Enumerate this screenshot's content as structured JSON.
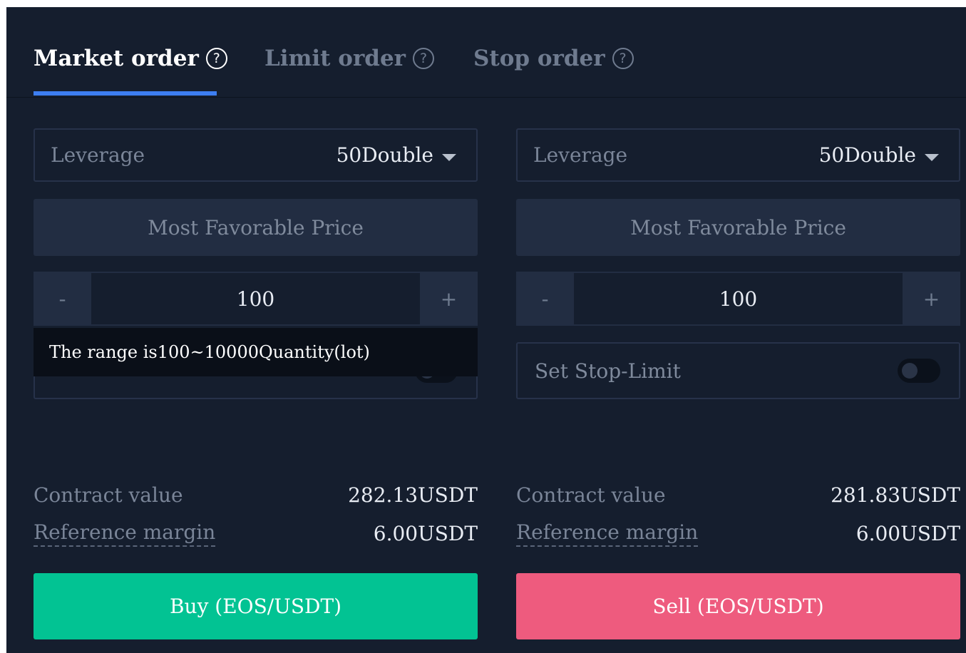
{
  "tabs": [
    {
      "label": "Market order",
      "help": "?"
    },
    {
      "label": "Limit order",
      "help": "?"
    },
    {
      "label": "Stop order",
      "help": "?"
    }
  ],
  "buy_panel": {
    "leverage_label": "Leverage",
    "leverage_value": "50Double",
    "price_button": "Most Favorable Price",
    "minus": "-",
    "quantity": "100",
    "plus": "+",
    "tooltip": "The range is100~10000Quantity(lot)",
    "contract_value_label": "Contract value",
    "contract_value": "282.13USDT",
    "reference_margin_label": "Reference margin",
    "reference_margin": "6.00USDT",
    "action_label": "Buy (EOS/USDT)"
  },
  "sell_panel": {
    "leverage_label": "Leverage",
    "leverage_value": "50Double",
    "price_button": "Most Favorable Price",
    "minus": "-",
    "quantity": "100",
    "plus": "+",
    "stop_limit_label": "Set Stop-Limit",
    "contract_value_label": "Contract value",
    "contract_value": "281.83USDT",
    "reference_margin_label": "Reference margin",
    "reference_margin": "6.00USDT",
    "action_label": "Sell (EOS/USDT)"
  },
  "colors": {
    "background": "#151e2e",
    "active_tab_underline": "#3d7ef1",
    "buy": "#02c393",
    "sell": "#ee5b7e"
  }
}
